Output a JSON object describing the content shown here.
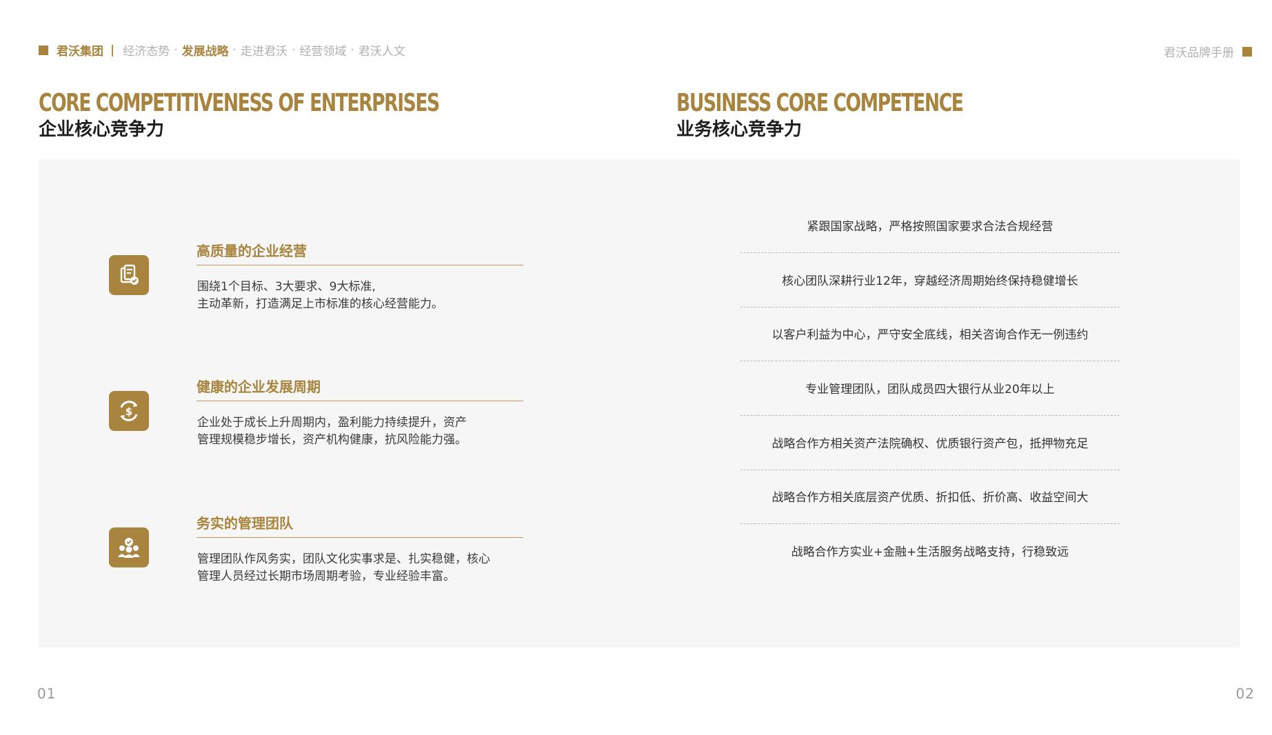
{
  "nav": {
    "brand": "君沃集团",
    "separator": "|",
    "items": [
      {
        "label": "经济态势",
        "active": false
      },
      {
        "label": "发展战略",
        "active": true
      },
      {
        "label": "走进君沃",
        "active": false
      },
      {
        "label": "经营领域",
        "active": false
      },
      {
        "label": "君沃人文",
        "active": false
      }
    ],
    "dot": "·"
  },
  "manual_label": "君沃品牌手册",
  "left_section": {
    "title_en": "CORE COMPETITIVENESS OF ENTERPRISES",
    "title_zh": "企业核心竞争力",
    "features": [
      {
        "icon": "document-check-icon",
        "title": "高质量的企业经营",
        "lines": [
          "围绕1个目标、3大要求、9大标准,",
          "主动革新，打造满足上市标准的核心经营能力。"
        ]
      },
      {
        "icon": "dollar-cycle-icon",
        "title": "健康的企业发展周期",
        "lines": [
          "企业处于成长上升周期内，盈利能力持续提升，资产",
          "管理规模稳步增长，资产机构健康，抗风险能力强。"
        ]
      },
      {
        "icon": "team-icon",
        "title": "务实的管理团队",
        "lines": [
          "管理团队作风务实，团队文化实事求是、扎实稳健，核心",
          "管理人员经过长期市场周期考验，专业经验丰富。"
        ]
      }
    ]
  },
  "right_section": {
    "title_en": "BUSINESS CORE COMPETENCE",
    "title_zh": "业务核心竞争力",
    "points": [
      "紧跟国家战略，严格按照国家要求合法合规经营",
      "核心团队深耕行业12年，穿越经济周期始终保持稳健增长",
      "以客户利益为中心，严守安全底线，相关咨询合作无一例违约",
      "专业管理团队，团队成员四大银行从业20年以上",
      "战略合作方相关资产法院确权、优质银行资产包，抵押物充足",
      "战略合作方相关底层资产优质、折扣低、折价高、收益空间大",
      "战略合作方实业+金融+生活服务战略支持，行稳致远"
    ]
  },
  "page_numbers": {
    "left": "01",
    "right": "02"
  },
  "colors": {
    "accent": "#a8843e",
    "panel": "#f6f6f6"
  }
}
